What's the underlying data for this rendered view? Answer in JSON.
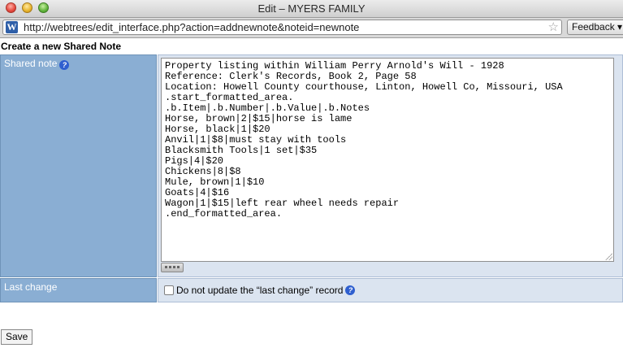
{
  "window": {
    "title": "Edit – MYERS FAMILY"
  },
  "browser": {
    "site_icon_letter": "W",
    "url": "http://webtrees/edit_interface.php?action=addnewnote&noteid=newnote",
    "feedback_label": "Feedback ▾"
  },
  "page": {
    "heading": "Create a new Shared Note",
    "shared_note": {
      "label": "Shared note",
      "help_glyph": "?",
      "lines": [
        "Property listing within William Perry Arnold's Will - 1928",
        "Reference: Clerk's Records, Book 2, Page 58",
        "Location: Howell County courthouse, Linton, Howell Co, Missouri, USA",
        ".start_formatted_area.",
        ".b.Item|.b.Number|.b.Value|.b.Notes",
        "Horse, brown|2|$15|horse is lame",
        "Horse, black|1|$20",
        "Anvil|1|$8|must stay with tools",
        "Blacksmith Tools|1 set|$35",
        "Pigs|4|$20",
        "Chickens|8|$8",
        "Mule, brown|1|$10",
        "Goats|4|$16",
        "Wagon|1|$15|left rear wheel needs repair",
        ".end_formatted_area."
      ]
    },
    "last_change": {
      "label": "Last change",
      "checkbox_label": "Do not update the “last change” record",
      "checked": false,
      "help_glyph": "?"
    },
    "save_label": "Save"
  }
}
